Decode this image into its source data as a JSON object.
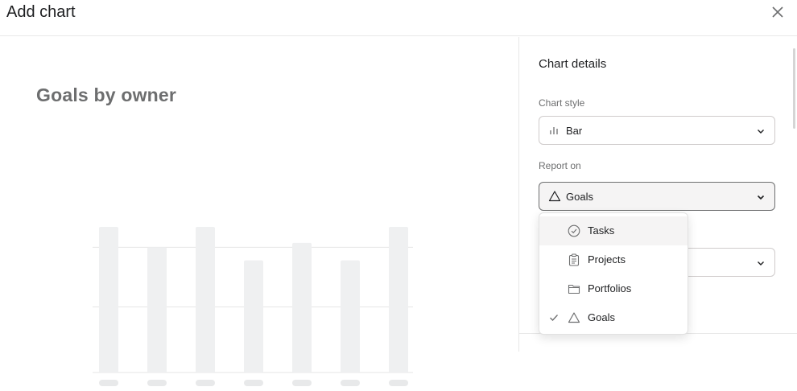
{
  "dialog": {
    "title": "Add chart"
  },
  "preview": {
    "title": "Goals by owner"
  },
  "details": {
    "heading": "Chart details",
    "chart_style": {
      "label": "Chart style",
      "value": "Bar",
      "icon": "bar-chart-icon"
    },
    "report_on": {
      "label": "Report on",
      "value": "Goals",
      "icon": "goal-triangle-icon"
    }
  },
  "menu": {
    "items": [
      {
        "label": "Tasks",
        "icon": "check-circle-icon",
        "selected": false,
        "hovered": true
      },
      {
        "label": "Projects",
        "icon": "clipboard-icon",
        "selected": false,
        "hovered": false
      },
      {
        "label": "Portfolios",
        "icon": "folder-icon",
        "selected": false,
        "hovered": false
      },
      {
        "label": "Goals",
        "icon": "goal-triangle-icon",
        "selected": true,
        "hovered": false
      }
    ]
  },
  "colors": {
    "bar": "#eff0f1",
    "gridline": "#e6e6e6",
    "label_placeholder": "#e8e9ea"
  },
  "chart_data": {
    "type": "bar",
    "categories": [
      "",
      "",
      "",
      "",
      "",
      "",
      ""
    ],
    "values": [
      10,
      8.6,
      10,
      7.7,
      8.9,
      7.7,
      10
    ],
    "ylim": [
      0,
      10
    ],
    "grid": true,
    "title": "Goals by owner"
  }
}
